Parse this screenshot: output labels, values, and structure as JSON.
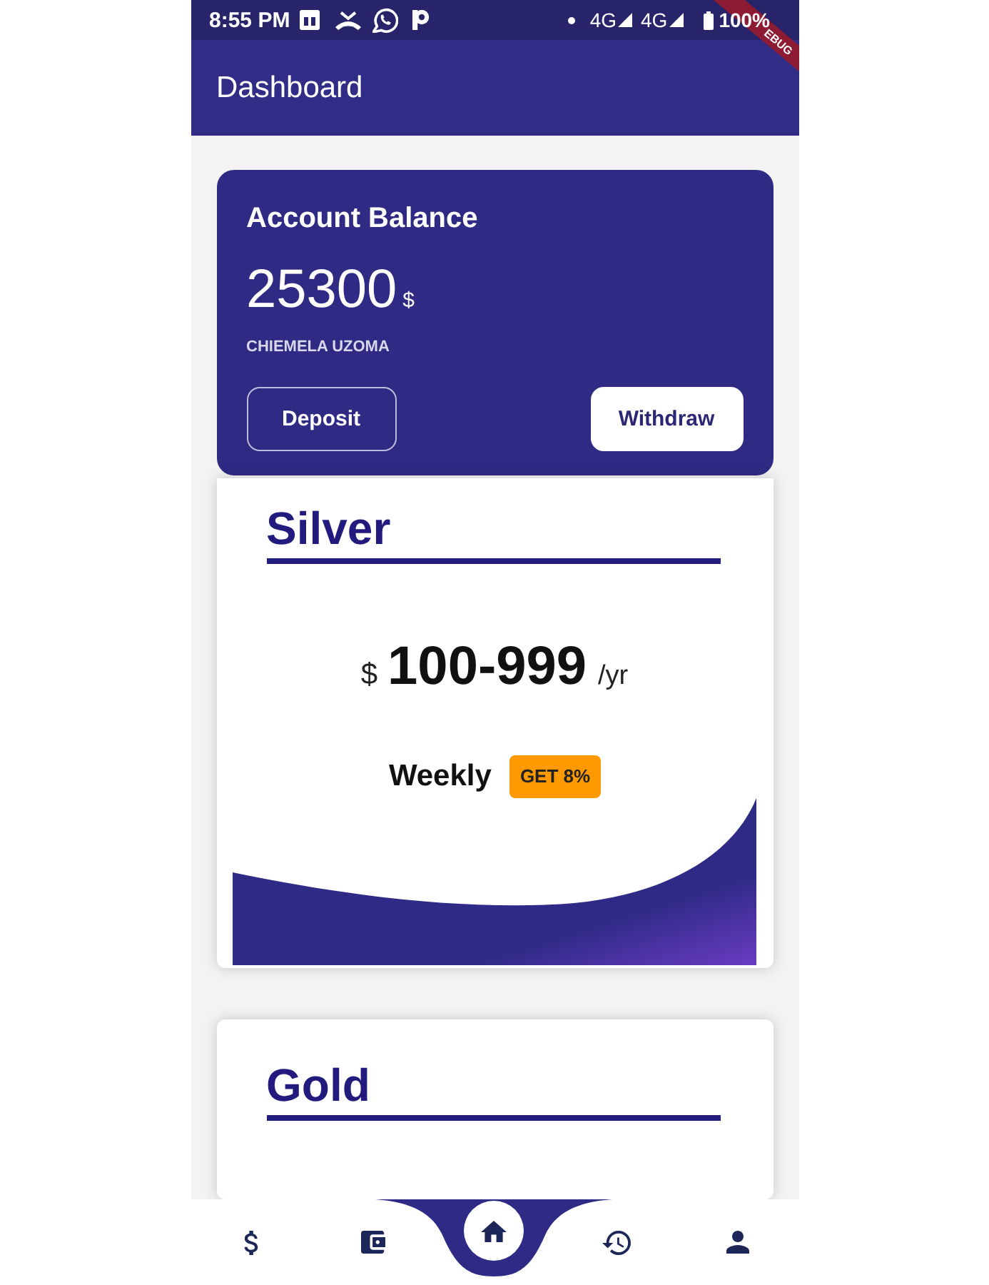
{
  "status_bar": {
    "time": "8:55 PM",
    "networks": [
      {
        "label": "4G"
      },
      {
        "label": "4G"
      }
    ],
    "battery": "100%"
  },
  "debug_banner": "EBUG",
  "app_bar": {
    "title": "Dashboard"
  },
  "balance_card": {
    "title": "Account Balance",
    "amount": "25300",
    "currency": "$",
    "holder": "CHIEMELA UZOMA",
    "actions": [
      {
        "label": "Deposit",
        "kind": "outlined"
      },
      {
        "label": "Withdraw",
        "kind": "filled"
      }
    ]
  },
  "plans": [
    {
      "name": "Silver",
      "currency": "$",
      "price": "100-999",
      "period": "/yr",
      "frequency": "Weekly",
      "badge": "GET 8%"
    },
    {
      "name": "Gold"
    }
  ],
  "bottom_nav": {
    "items": [
      {
        "kind": "dollar",
        "selected": false
      },
      {
        "kind": "wallet",
        "selected": false
      },
      {
        "kind": "home",
        "selected": true
      },
      {
        "kind": "history",
        "selected": false
      },
      {
        "kind": "profile",
        "selected": false
      }
    ]
  }
}
